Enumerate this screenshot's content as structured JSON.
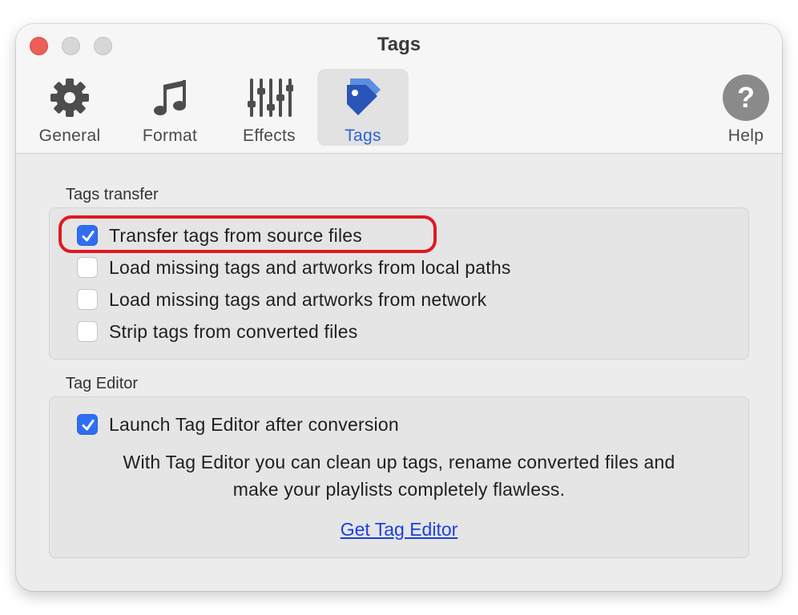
{
  "window": {
    "title": "Tags"
  },
  "toolbar": {
    "items": [
      {
        "label": "General",
        "icon": "gear-icon"
      },
      {
        "label": "Format",
        "icon": "music-note-icon"
      },
      {
        "label": "Effects",
        "icon": "sliders-icon"
      },
      {
        "label": "Tags",
        "icon": "tag-icon",
        "selected": true
      },
      {
        "label": "Help",
        "icon": "help-icon"
      }
    ]
  },
  "tags_transfer": {
    "title": "Tags transfer",
    "options": [
      {
        "label": "Transfer tags from source files",
        "checked": true
      },
      {
        "label": "Load missing tags and artworks from local paths",
        "checked": false
      },
      {
        "label": "Load missing tags and artworks from network",
        "checked": false
      },
      {
        "label": "Strip tags from converted files",
        "checked": false
      }
    ]
  },
  "tag_editor": {
    "title": "Tag Editor",
    "launch_option": {
      "label": "Launch Tag Editor after conversion",
      "checked": true
    },
    "description_line1": "With Tag Editor you can clean up tags, rename converted files and",
    "description_line2": "make your playlists completely flawless.",
    "link_label": "Get Tag Editor"
  },
  "colors": {
    "accent": "#2f6ef3",
    "highlight": "#e0191f",
    "link": "#1a3fe0",
    "window_bg": "#ececec"
  }
}
